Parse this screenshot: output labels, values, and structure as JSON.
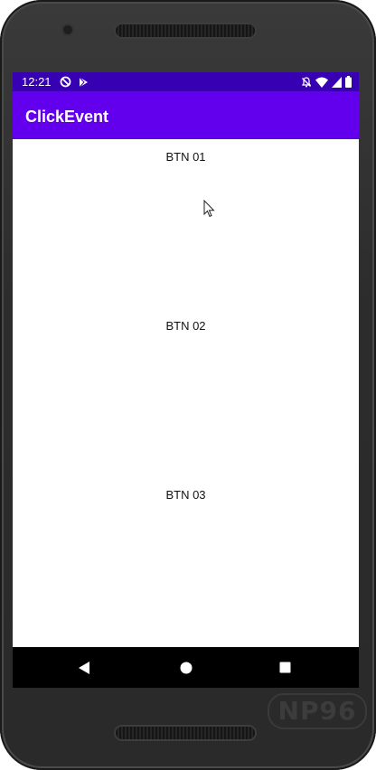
{
  "status_bar": {
    "time": "12:21",
    "left_icons": [
      "sync-off-icon",
      "play-store-icon"
    ],
    "right_icons": [
      "notifications-off-icon",
      "wifi-icon",
      "signal-icon",
      "battery-icon"
    ],
    "background_color": "#3700b3"
  },
  "app_bar": {
    "title": "ClickEvent",
    "background_color": "#6200ee"
  },
  "main": {
    "buttons": [
      {
        "label": "BTN 01"
      },
      {
        "label": "BTN 02"
      },
      {
        "label": "BTN 03"
      }
    ]
  },
  "nav_bar": {
    "icons": [
      "back-icon",
      "home-icon",
      "recents-icon"
    ]
  },
  "watermark": {
    "text": "NP96"
  }
}
